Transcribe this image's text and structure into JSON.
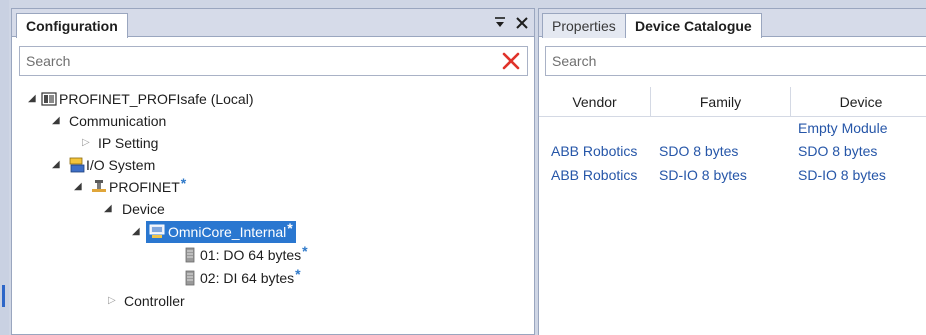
{
  "left_pane": {
    "tab_label": "Configuration",
    "pin_glyph": "≡",
    "close_glyph": "✕",
    "search_placeholder": "Search",
    "tree": {
      "root": "PROFINET_PROFIsafe (Local)",
      "communication": "Communication",
      "ip_setting": "IP Setting",
      "io_system": "I/O System",
      "profinet": "PROFINET",
      "device": "Device",
      "omnicore": "OmniCore_Internal",
      "do_module": "01: DO 64 bytes",
      "di_module": "02: DI 64 bytes",
      "controller": "Controller",
      "modified_marker": "*"
    }
  },
  "right_pane": {
    "tabs": [
      "Properties",
      "Device Catalogue"
    ],
    "search_placeholder": "Search",
    "columns": [
      "Vendor",
      "Family",
      "Device"
    ],
    "rows": [
      {
        "vendor": "",
        "family": "",
        "device": "Empty Module"
      },
      {
        "vendor": "ABB Robotics",
        "family": "SDO 8 bytes",
        "device": "SDO 8 bytes"
      },
      {
        "vendor": "ABB Robotics",
        "family": "SD-IO 8 bytes",
        "device": "SD-IO 8 bytes"
      }
    ]
  },
  "icons": {
    "expanded_arrow": "expanded-arrow-icon",
    "collapsed_arrow": "collapsed-arrow-icon",
    "controller": "controller-icon",
    "io_system": "io-system-icon",
    "network": "network-icon",
    "device": "device-icon",
    "module": "module-icon",
    "clear": "clear-search-icon"
  },
  "colors": {
    "selection": "#2a77d0",
    "link_text": "#2656a8",
    "modified_marker": "#2f79c9",
    "clear_icon": "#e0322a"
  }
}
